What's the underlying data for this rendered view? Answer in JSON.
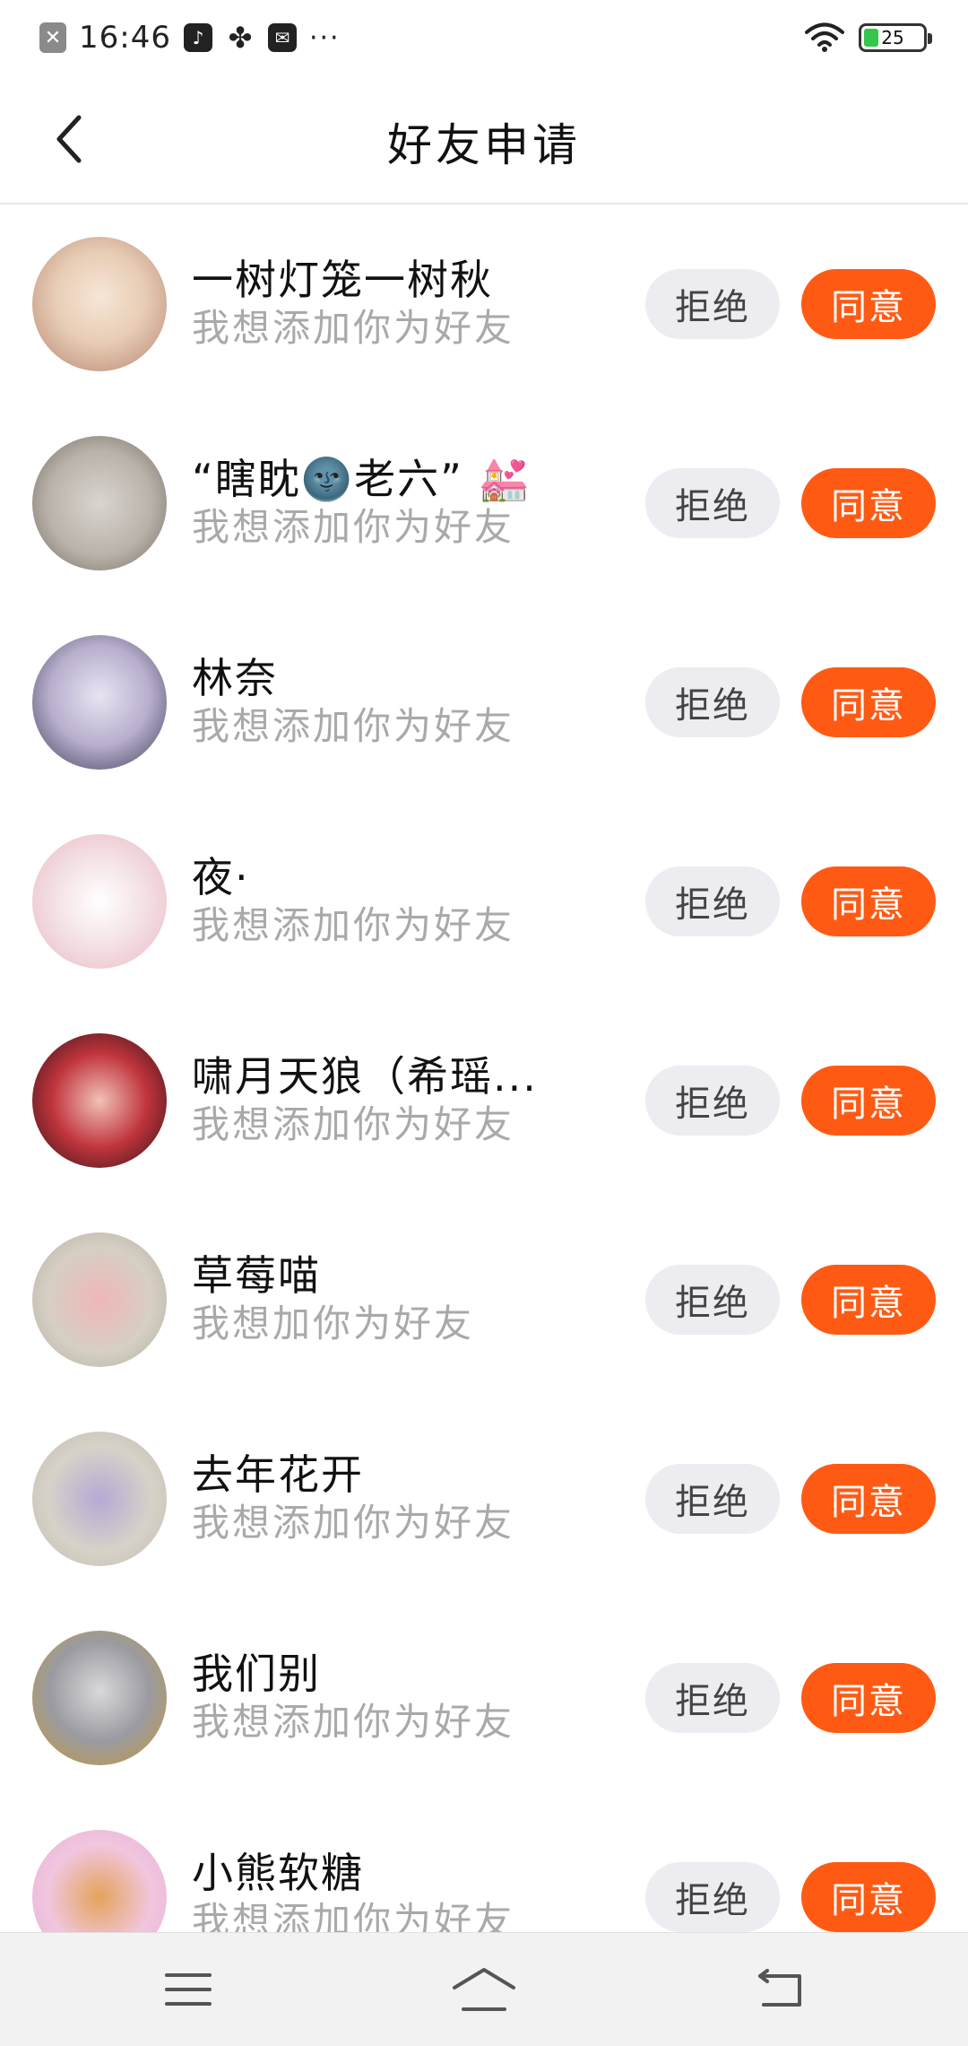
{
  "status_bar": {
    "time": "16:46",
    "more_indicator": "···",
    "battery_level": "25",
    "icons": [
      "notification-x-icon",
      "music-app-icon",
      "fan-app-icon",
      "mail-app-icon",
      "wifi-icon",
      "battery-icon"
    ]
  },
  "header": {
    "title": "好友申请",
    "back_icon": "chevron-left-icon"
  },
  "buttons": {
    "reject": "拒绝",
    "agree": "同意"
  },
  "colors": {
    "agree": "#ff5a14",
    "reject_bg": "#ececf1",
    "subtitle": "#a9a9a9"
  },
  "requests": [
    {
      "name": "一树灯笼一树秋",
      "message": "我想添加你为好友"
    },
    {
      "name": "“瞎眈🌚老六” 💒",
      "message": "我想添加你为好友"
    },
    {
      "name": "林奈",
      "message": "我想添加你为好友"
    },
    {
      "name": "夜·",
      "message": "我想添加你为好友"
    },
    {
      "name": "啸月天狼（希瑶...",
      "message": "我想添加你为好友"
    },
    {
      "name": "草莓喵",
      "message": "我想加你为好友"
    },
    {
      "name": "去年花开",
      "message": "我想添加你为好友"
    },
    {
      "name": "我们别",
      "message": "我想添加你为好友"
    },
    {
      "name": "小熊软糖",
      "message": "我想添加你为好友"
    }
  ],
  "nav_bar": {
    "icons": [
      "menu-icon",
      "home-icon",
      "back-icon"
    ]
  }
}
